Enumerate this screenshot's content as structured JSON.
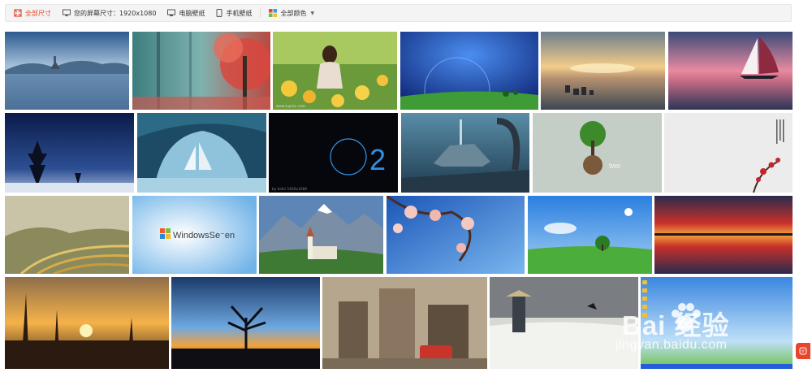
{
  "filters": {
    "all_sizes": "全部尺寸",
    "screen_size_label": "您的屏幕尺寸：",
    "screen_size_value": "1920x1080",
    "desktop_wallpaper": "电脑壁纸",
    "mobile_wallpaper": "手机壁纸",
    "all_colors": "全部颜色",
    "active_color": "#e54a2b"
  },
  "thumbnails": {
    "row1": [
      "lake-island",
      "pink-forest",
      "girl-in-flowers",
      "blue-planet-field",
      "sunset-sea-rocks",
      "sailboat-sunset"
    ],
    "row2": [
      "night-sky-trees",
      "ice-cave-ship",
      "dark-ring-2",
      "scifi-city",
      "tree-globe-two",
      "plum-blossom-ink"
    ],
    "row3": [
      "rice-terraces",
      "windows-seven-clouds",
      "castle-mountains",
      "cherry-blossom-sky",
      "green-meadow-tree",
      "red-sky-reflection"
    ],
    "row4": [
      "sunset-grass",
      "tree-silhouette-sunset",
      "ruined-city",
      "samurai-field",
      "windows-xp-desktop"
    ]
  },
  "overlays": {
    "two_digit": "2",
    "two_word": "two",
    "windows_text": "WindowsSeven",
    "windows_text_display": "WindowsSe⁻en"
  },
  "watermark": {
    "logo": "Bai 经验",
    "url": "jingyan.baidu.com"
  },
  "credits": {
    "c1": "www.tupian.com",
    "c2": "by bizhi 1920x1080"
  }
}
